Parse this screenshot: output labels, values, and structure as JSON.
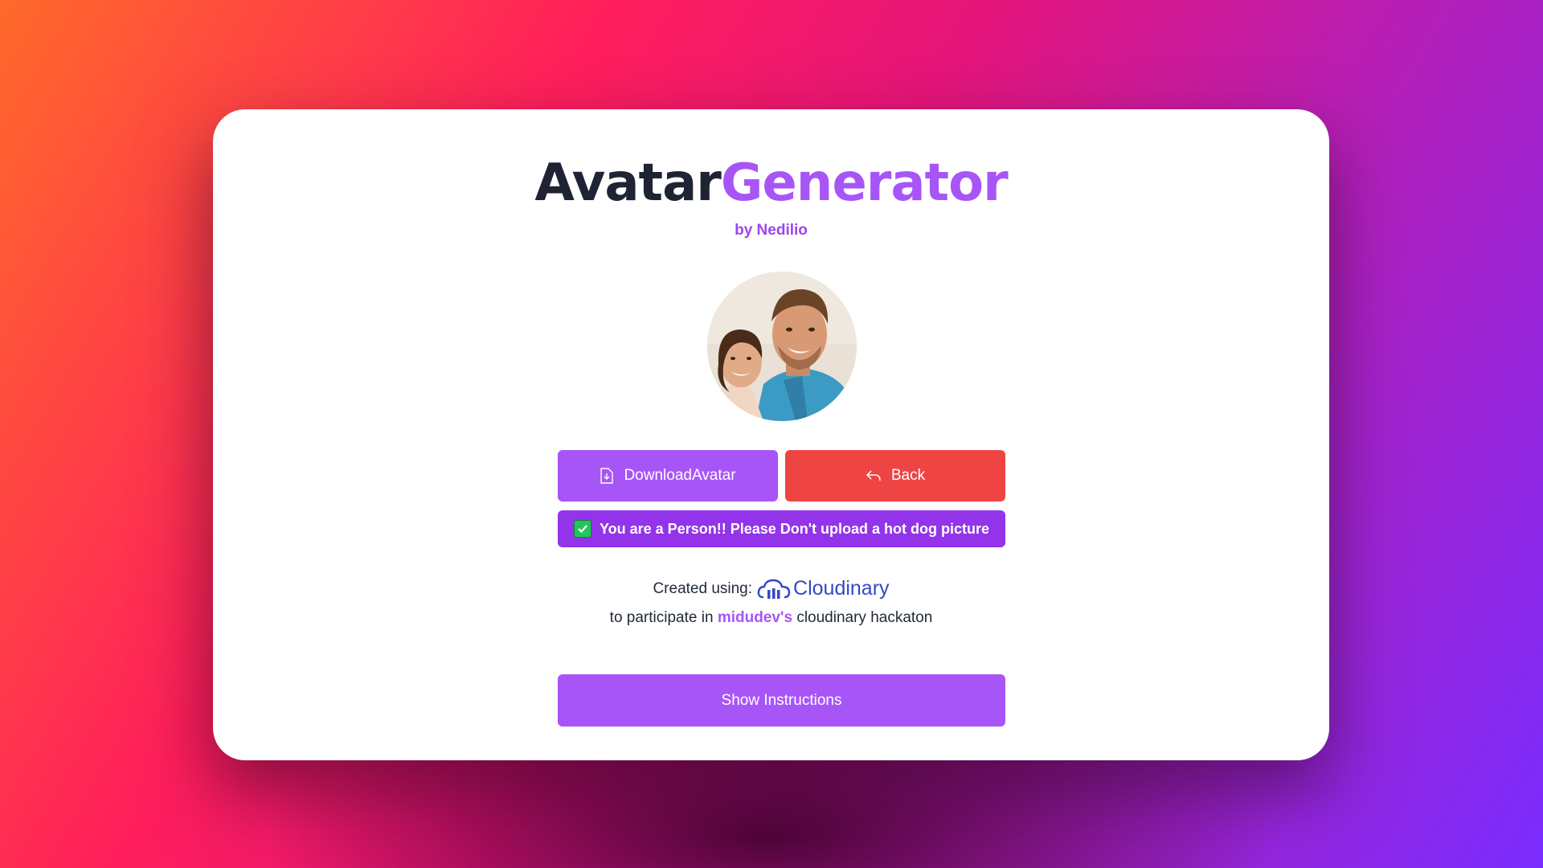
{
  "header": {
    "title_part1": "Avatar",
    "title_part2": "Generator",
    "byline": "by Nedilio"
  },
  "avatar": {
    "alt": "Generated avatar photo"
  },
  "actions": {
    "download_label": "DownloadAvatar",
    "back_label": "Back"
  },
  "status": {
    "message": "You are a Person!! Please Don't upload a hot dog picture",
    "icon": "check-mark-icon"
  },
  "credits": {
    "created_label": "Created using:",
    "brand_name": "Cloudinary",
    "participate_prefix": "to participate in",
    "participate_highlight": "midudev's",
    "participate_suffix": "cloudinary hackaton"
  },
  "footer": {
    "instructions_label": "Show Instructions"
  },
  "colors": {
    "accent": "#a855f7",
    "danger": "#ef4444",
    "status_bg": "#9333ea",
    "brand_blue": "#3448c5",
    "title_dark": "#1e2433"
  }
}
